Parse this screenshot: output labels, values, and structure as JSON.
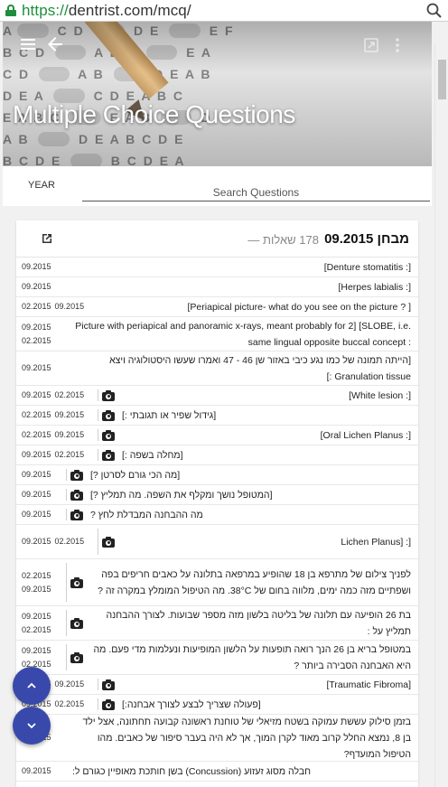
{
  "browser": {
    "url_scheme": "https://",
    "url_rest": "dentrist.com/mcq/"
  },
  "hero": {
    "title": "Multiple Choice Questions"
  },
  "filters": {
    "year_label": "YEAR",
    "search_placeholder": "Search Questions"
  },
  "exam": {
    "title": "מבחן 09.2015",
    "count": "178 שאלות —"
  },
  "questions": [
    {
      "dates": [
        "09.2015"
      ],
      "layout": "inline",
      "camera": false,
      "text": "[Denture stomatitis :]"
    },
    {
      "dates": [
        "09.2015"
      ],
      "layout": "inline",
      "camera": false,
      "text": "[Herpes labialis :]"
    },
    {
      "dates": [
        "02.2015",
        "09.2015"
      ],
      "layout": "inline",
      "camera": false,
      "text": "[Periapical picture- what do you see on the picture ? ]"
    },
    {
      "dates": [
        "09.2015",
        "02.2015"
      ],
      "layout": "stack",
      "camera": false,
      "text": "Picture with periapical and panoramic x-rays, meant probably for 2] [SLOBE, i.e. same lingual opposite buccal concept :"
    },
    {
      "dates": [
        "09.2015"
      ],
      "layout": "stack",
      "camera": false,
      "text": "[הייתה תמונה של כמו נגע כיבי באזור שן 46 - 47 ואמרו שעשו היסטולוגיה ויצא Granulation tissue :]"
    },
    {
      "dates": [
        "09.2015",
        "02.2015"
      ],
      "layout": "inline",
      "camera": true,
      "text": "[White lesion :]"
    },
    {
      "dates": [
        "02.2015",
        "09.2015"
      ],
      "layout": "inline",
      "camera": true,
      "text": "[גידול שפיר או תגובתי :]"
    },
    {
      "dates": [
        "02.2015",
        "09.2015"
      ],
      "layout": "inline",
      "camera": true,
      "text": "[Oral Lichen Planus :]"
    },
    {
      "dates": [
        "09.2015",
        "02.2015"
      ],
      "layout": "inline",
      "camera": true,
      "text": "[מחלה בשפה :]"
    },
    {
      "dates": [
        "09.2015"
      ],
      "layout": "inline",
      "camera": true,
      "text": "[מה הכי גורם לסרטן ?]"
    },
    {
      "dates": [
        "09.2015"
      ],
      "layout": "inline",
      "camera": true,
      "text": "[המטופל נושך ומקלף את השפה. מה תמליץ ?]"
    },
    {
      "dates": [
        "09.2015"
      ],
      "layout": "inline",
      "camera": true,
      "text": "מה ההבחנה המבדלת לחץ ?"
    },
    {
      "dates": [
        "09.2015",
        "02.2015"
      ],
      "layout": "inline",
      "camera": true,
      "text": "Lichen Planus] :]"
    },
    {
      "dates": [
        "02.2015",
        "09.2015"
      ],
      "layout": "stack",
      "camera": true,
      "text": "לפניך צילום של מתרפא בן 18 שהופיע במרפאה בתלונה על כאבים חריפים בפה ושפתיים מזה כמה ימים, מלווה בחום של 38°C. מה הטיפול המומלץ במקרה זה ?"
    },
    {
      "dates": [
        "09.2015",
        "02.2015"
      ],
      "layout": "stack",
      "camera": true,
      "text": "בת 26 הופיעה עם תלונה של בליטה בלשון מזה מספר שבועות. לצורך ההבחנה תמליץ על :"
    },
    {
      "dates": [
        "09.2015",
        "02.2015"
      ],
      "layout": "stack",
      "camera": true,
      "text": "במטופל בריא בן 26 הנך רואה תופעות על הלשון המופיעות ונעלמות מדי פעם. מה היא האבחנה הסבירה ביותר ?"
    },
    {
      "dates": [
        "02.2015",
        "09.2015"
      ],
      "layout": "inline",
      "camera": true,
      "text": "[Traumatic Fibroma]"
    },
    {
      "dates": [
        "09.2015",
        "02.2015"
      ],
      "layout": "inline",
      "camera": true,
      "text": "[פעולה שצריך לבצע לצורך אבחנה:]"
    },
    {
      "dates": [
        "09.2015"
      ],
      "layout": "stack",
      "camera": false,
      "text": "בזמן סילוק עששת עמוקה בשטח מזיאלי של טוחנת ראשונה קבועה תחתונה, אצל ילד בן 8, נמצא החלל קרוב מאוד לקרן המוך, אך לא היה בעבר סיפור של כאבים. מהו הטיפול המועדף?"
    },
    {
      "dates": [
        "09.2015"
      ],
      "layout": "inline",
      "camera": false,
      "text": "חבלה מסוג זעזוע (Concussion) בשן חותכת מאופיין כגורם ל:"
    }
  ]
}
